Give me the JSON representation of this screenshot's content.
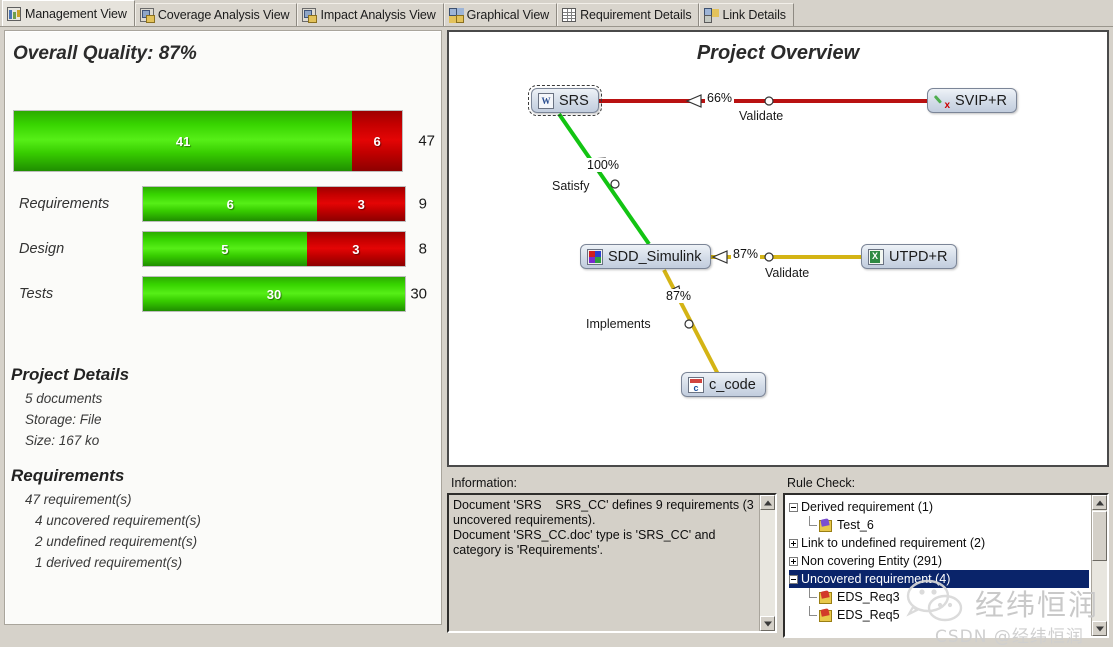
{
  "tabs": [
    {
      "label": "Management View",
      "icon": "management-view-icon",
      "active": true
    },
    {
      "label": "Coverage Analysis View",
      "icon": "coverage-analysis-icon",
      "active": false
    },
    {
      "label": "Impact Analysis View",
      "icon": "impact-analysis-icon",
      "active": false
    },
    {
      "label": "Graphical View",
      "icon": "graphical-view-icon",
      "active": false
    },
    {
      "label": "Requirement Details",
      "icon": "requirement-details-icon",
      "active": false
    },
    {
      "label": "Link Details",
      "icon": "link-details-icon",
      "active": false
    }
  ],
  "management": {
    "overall_quality_title": "Overall Quality: 87%",
    "overall_bar": {
      "green_value": "41",
      "red_value": "6",
      "total": "47"
    },
    "rows": [
      {
        "label": "Requirements",
        "green_value": "6",
        "red_value": "3",
        "total": "9"
      },
      {
        "label": "Design",
        "green_value": "5",
        "red_value": "3",
        "total": "8"
      },
      {
        "label": "Tests",
        "green_value": "30",
        "red_value": "",
        "total": "30"
      }
    ],
    "project_details_title": "Project Details",
    "project_details": [
      "5 documents",
      "Storage: File",
      "Size: 167 ko"
    ],
    "requirements_title": "Requirements",
    "requirements": [
      "47 requirement(s)",
      "4 uncovered requirement(s)",
      "2 undefined requirement(s)",
      "1 derived requirement(s)"
    ]
  },
  "diagram": {
    "title": "Project Overview",
    "nodes": {
      "srs": {
        "label": "SRS",
        "icon": "word-document-icon"
      },
      "svip": {
        "label": "SVIP+R",
        "icon": "check-mark-icon"
      },
      "sdd": {
        "label": "SDD_Simulink",
        "icon": "simulink-model-icon"
      },
      "utpd": {
        "label": "UTPD+R",
        "icon": "excel-document-icon"
      },
      "ccode": {
        "label": "c_code",
        "icon": "c-source-file-icon"
      }
    },
    "edges": {
      "validate_top": {
        "percent": "66%",
        "label": "Validate",
        "color": "#b91111"
      },
      "satisfy": {
        "percent": "100%",
        "label": "Satisfy",
        "color": "#13c413"
      },
      "validate_mid": {
        "percent": "87%",
        "label": "Validate",
        "color": "#d4b415"
      },
      "implements": {
        "percent": "87%",
        "label": "Implements",
        "color": "#d4b415"
      }
    }
  },
  "information": {
    "caption": "Information:",
    "text": "Document 'SRS    SRS_CC' defines 9 requirements (3 uncovered requirements).\nDocument 'SRS_CC.doc' type is 'SRS_CC' and category is 'Requirements'."
  },
  "rule_check": {
    "caption": "Rule Check:",
    "rows": [
      {
        "text": "Derived requirement (1)",
        "level": 0,
        "toggle": "minus",
        "icon": "none",
        "selected": false
      },
      {
        "text": "Test_6",
        "level": 1,
        "toggle": "none",
        "icon": "test-icon",
        "selected": false
      },
      {
        "text": "Link to undefined requirement (2)",
        "level": 0,
        "toggle": "plus",
        "icon": "none",
        "selected": false
      },
      {
        "text": "Non covering Entity (291)",
        "level": 0,
        "toggle": "plus",
        "icon": "none",
        "selected": false
      },
      {
        "text": "Uncovered requirement (4)",
        "level": 0,
        "toggle": "minus",
        "icon": "none",
        "selected": true
      },
      {
        "text": "EDS_Req3",
        "level": 1,
        "toggle": "none",
        "icon": "req-icon",
        "selected": false
      },
      {
        "text": "EDS_Req5",
        "level": 1,
        "toggle": "none",
        "icon": "req-icon",
        "selected": false
      }
    ]
  },
  "watermark": {
    "chinese": "经纬恒润",
    "csdn": "CSDN @经纬恒润"
  },
  "colors": {
    "green": "#37d400",
    "red": "#c40000",
    "selection_blue": "#0a246a",
    "edge_red": "#b91111",
    "edge_green": "#13c413",
    "edge_yellow": "#d4b415"
  }
}
